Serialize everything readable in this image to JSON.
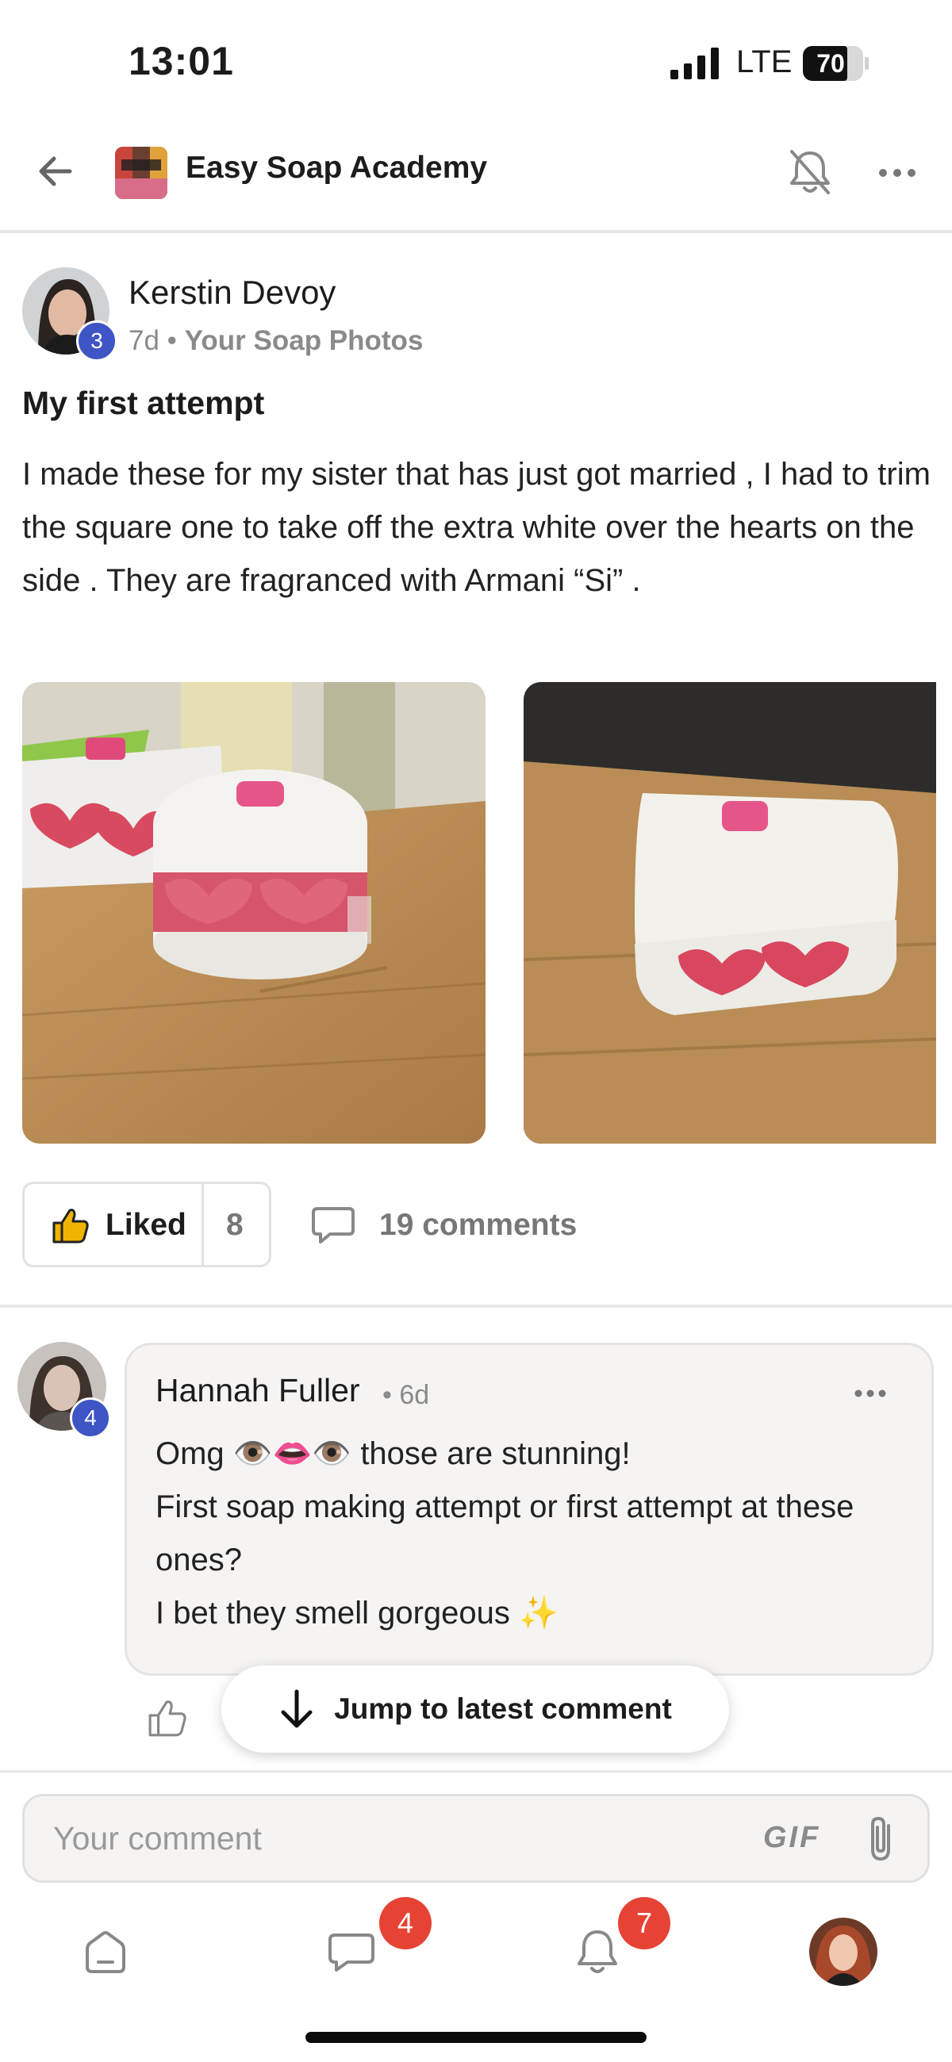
{
  "status_bar": {
    "time": "13:01",
    "network": "LTE",
    "battery": "70"
  },
  "header": {
    "group_name": "Easy Soap Academy"
  },
  "post": {
    "author": "Kerstin Devoy",
    "author_level": "3",
    "age": "7d",
    "category": "Your Soap Photos",
    "title": "My first attempt",
    "body": "I made these for my sister that has just got married , I had to trim the square one to take off the extra white over the hearts on the side . They are fragranced with Armani “Si” .",
    "like_label": "Liked",
    "like_count": "8",
    "comments_label": "19 comments"
  },
  "comment": {
    "author": "Hannah Fuller",
    "author_level": "4",
    "age": "• 6d",
    "text": "Omg 👁️👄👁️ those are stunning!\nFirst soap making attempt or first attempt at these ones?\nI bet they smell gorgeous ✨"
  },
  "jump_button": {
    "label": "Jump to latest comment"
  },
  "composer": {
    "placeholder": "Your comment",
    "gif_label": "GIF"
  },
  "tab_bar": {
    "chat_badge": "4",
    "notifications_badge": "7"
  },
  "colors": {
    "level_badge": "#3e55c6",
    "count_badge": "#e64335",
    "like_icon": "#f0b400"
  }
}
